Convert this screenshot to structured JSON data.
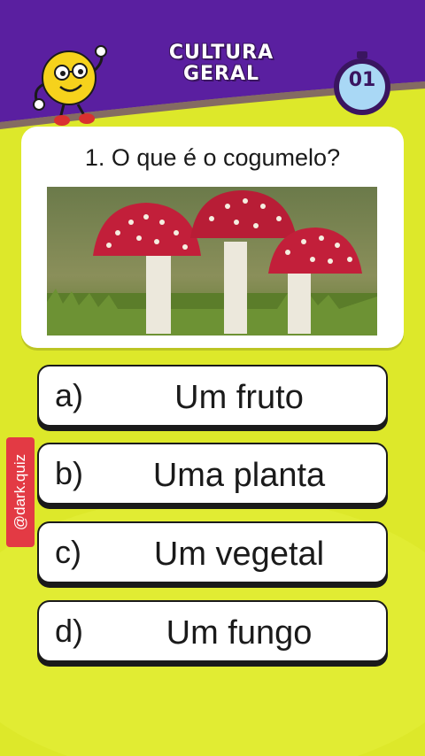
{
  "header": {
    "title_line1": "CULTURA",
    "title_line2": "GERAL",
    "timer_value": "01"
  },
  "question": {
    "text": "1. O que é o cogumelo?",
    "image_subject": "red spotted mushrooms"
  },
  "answers": [
    {
      "letter": "a)",
      "text": "Um fruto"
    },
    {
      "letter": "b)",
      "text": "Uma planta"
    },
    {
      "letter": "c)",
      "text": "Um vegetal"
    },
    {
      "letter": "d)",
      "text": "Um fungo"
    }
  ],
  "watermark": "@dark.quiz",
  "colors": {
    "background": "#dde82a",
    "header": "#5a1fa0",
    "timer": "#a9d8f5",
    "watermark": "#e33a44"
  },
  "icons": {
    "mascot": "smiley-mascot-icon",
    "timer": "stopwatch-icon"
  }
}
